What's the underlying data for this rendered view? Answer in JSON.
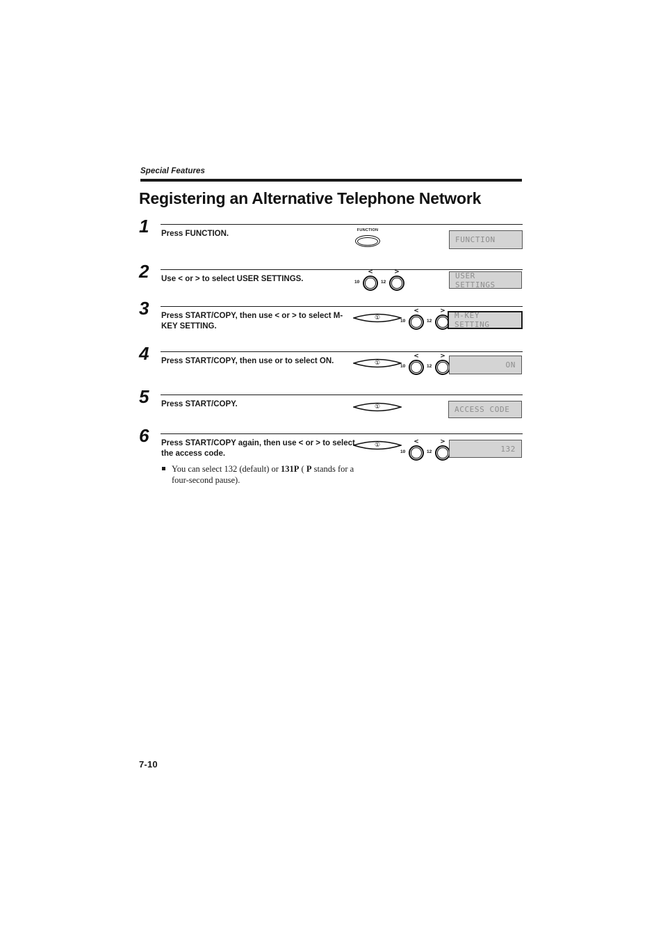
{
  "running_head": "Special Features",
  "title": "Registering an Alternative Telephone Network",
  "folio": "7-10",
  "keys": {
    "function_label": "FUNCTION",
    "left_arrow": "<",
    "right_arrow": ">",
    "left_key_number": "10",
    "right_key_number": "12",
    "start_copy_symbol": "①"
  },
  "steps": [
    {
      "number": "1",
      "text": "Press FUNCTION.",
      "lcd": "FUNCTION",
      "lcd_align": "left"
    },
    {
      "number": "2",
      "text": "Use < or > to select USER SETTINGS.",
      "lcd": "USER SETTINGS",
      "lcd_align": "left"
    },
    {
      "number": "3",
      "text": "Press START/COPY, then use < or > to select M-KEY SETTING.",
      "lcd": "M-KEY SETTING",
      "lcd_align": "left"
    },
    {
      "number": "4",
      "text": "Press START/COPY, then use or to select ON.",
      "lcd": "ON",
      "lcd_align": "right"
    },
    {
      "number": "5",
      "text": "Press START/COPY.",
      "lcd": "ACCESS CODE",
      "lcd_align": "left"
    },
    {
      "number": "6",
      "text": "Press START/COPY again, then use < or > to select the access code.",
      "lcd": "132",
      "lcd_align": "right"
    }
  ],
  "note": {
    "part1": "You can select 132 (default) or ",
    "bold1": "131P",
    "part2": " ( ",
    "bold2": "P",
    "part3": "  stands for a four-second pause)."
  },
  "colors": {
    "lcd_background": "#d4d4d4",
    "lcd_text": "#8d8d8d",
    "ink": "#1a1a1a"
  }
}
